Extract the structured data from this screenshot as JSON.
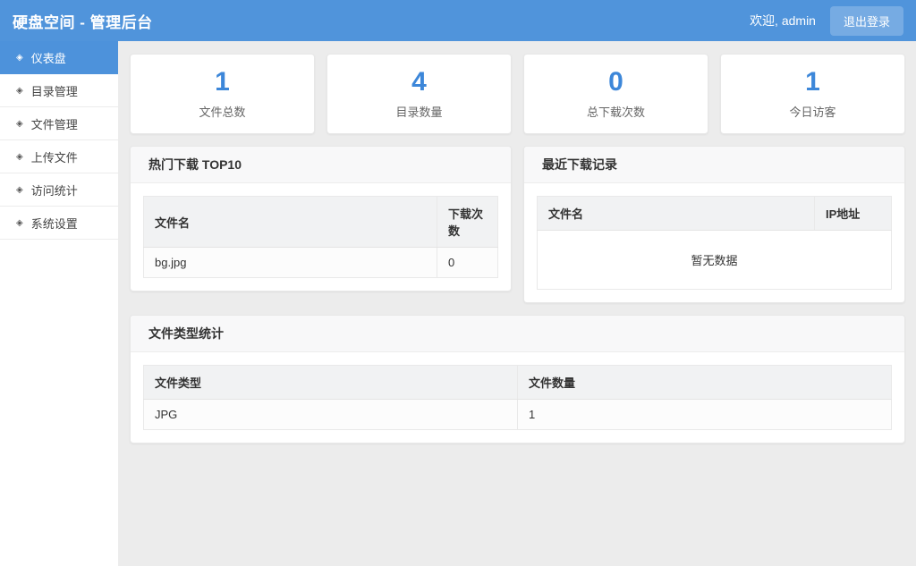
{
  "header": {
    "title": "硬盘空间 - 管理后台",
    "welcome": "欢迎, admin",
    "logout_label": "退出登录"
  },
  "sidebar": {
    "item_icon": "◈",
    "items": [
      {
        "label": "仪表盘",
        "active": true
      },
      {
        "label": "目录管理",
        "active": false
      },
      {
        "label": "文件管理",
        "active": false
      },
      {
        "label": "上传文件",
        "active": false
      },
      {
        "label": "访问统计",
        "active": false
      },
      {
        "label": "系统设置",
        "active": false
      }
    ]
  },
  "stats": [
    {
      "value": "1",
      "label": "文件总数"
    },
    {
      "value": "4",
      "label": "目录数量"
    },
    {
      "value": "0",
      "label": "总下载次数"
    },
    {
      "value": "1",
      "label": "今日访客"
    }
  ],
  "panels": {
    "hot_downloads": {
      "title": "热门下载 TOP10",
      "columns": [
        "文件名",
        "下载次数"
      ],
      "rows": [
        [
          "bg.jpg",
          "0"
        ]
      ]
    },
    "recent_downloads": {
      "title": "最近下载记录",
      "columns": [
        "文件名",
        "IP地址"
      ],
      "rows": [],
      "empty_text": "暂无数据"
    },
    "file_types": {
      "title": "文件类型统计",
      "columns": [
        "文件类型",
        "文件数量"
      ],
      "rows": [
        [
          "JPG",
          "1"
        ]
      ]
    }
  },
  "colors": {
    "header_bg": "#5094db",
    "active_item_bg": "#4d92db",
    "stat_number": "#3d87d9"
  }
}
